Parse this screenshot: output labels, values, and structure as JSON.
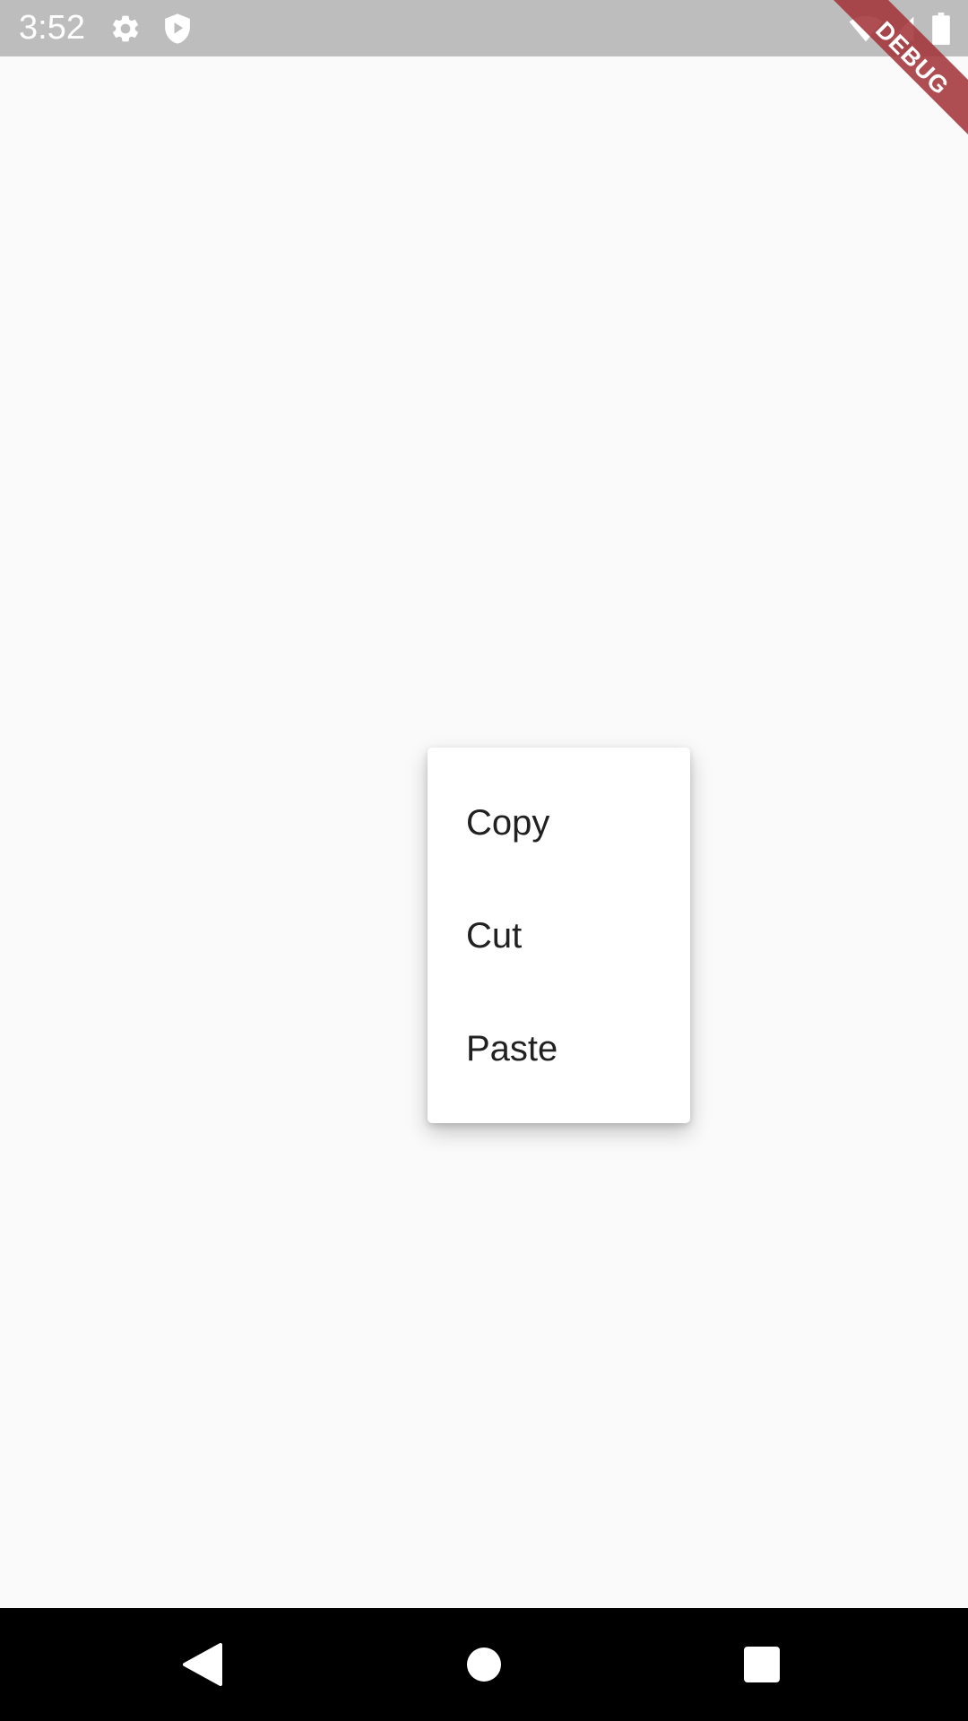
{
  "status_bar": {
    "time": "3:52",
    "left_icons": [
      "settings-gear-icon",
      "shield-play-icon"
    ],
    "right_icons": [
      "wifi-icon",
      "cellular-signal-icon",
      "battery-icon"
    ],
    "background_color": "#bdbdbd"
  },
  "debug_banner": {
    "label": "DEBUG",
    "color": "#a4353a"
  },
  "popup_menu": {
    "items": [
      {
        "label": "Copy"
      },
      {
        "label": "Cut"
      },
      {
        "label": "Paste"
      }
    ]
  },
  "nav_bar": {
    "buttons": [
      "back-icon",
      "home-icon",
      "recents-icon"
    ]
  },
  "colors": {
    "page_background": "#fafafa",
    "menu_background": "#ffffff",
    "menu_text": "#212121"
  }
}
